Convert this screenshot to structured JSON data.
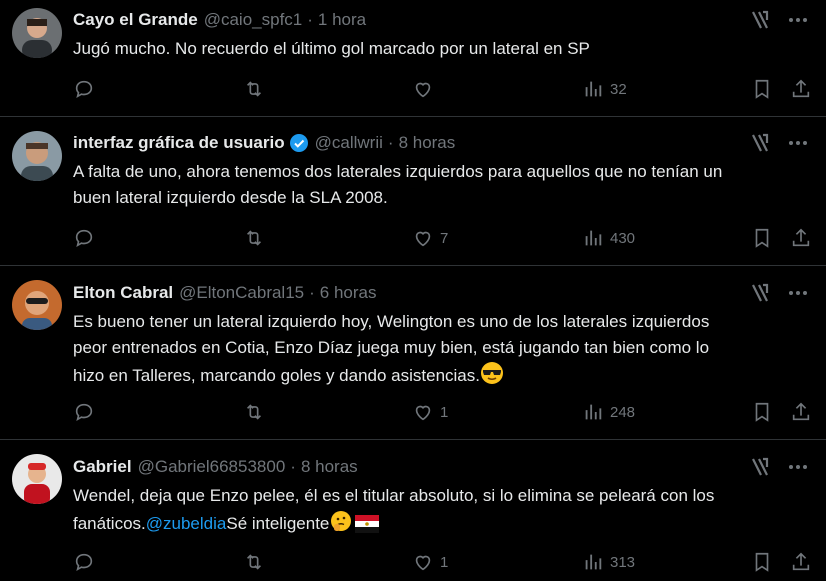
{
  "tweets": [
    {
      "name": "Cayo el Grande",
      "handle": "@caio_spfc1",
      "time": "1 hora",
      "verified": false,
      "lines": [
        "Jugó mucho. No recuerdo el último gol marcado por un lateral en SP"
      ],
      "likes": "",
      "views": "32"
    },
    {
      "name": "interfaz gráfica de usuario",
      "handle": "@callwrii",
      "time": "8 horas",
      "verified": true,
      "lines": [
        "A falta de uno, ahora tenemos dos laterales izquierdos para aquellos que no tenían un",
        "buen lateral izquierdo desde la SLA 2008."
      ],
      "likes": "7",
      "views": "430"
    },
    {
      "name": "Elton Cabral",
      "handle": "@EltonCabral15",
      "time": "6 horas",
      "verified": false,
      "lines": [
        "Es bueno tener un lateral izquierdo hoy, Welington es uno de los laterales izquierdos",
        "peor entrenados en Cotia, Enzo Díaz juega muy bien, está jugando tan bien como lo",
        "hizo en Talleres, marcando goles y dando asistencias."
      ],
      "likes": "1",
      "views": "248"
    },
    {
      "name": "Gabriel",
      "handle": "@Gabriel66853800",
      "time": "8 horas",
      "verified": false,
      "lines": [
        "Wendel, deja que Enzo pelee, él es el titular absoluto, si lo elimina se peleará con los"
      ],
      "line2_prefix": "fanáticos.",
      "line2_mention": "@zubeldia",
      "line2_suffix": "Sé inteligente",
      "likes": "1",
      "views": "313"
    }
  ],
  "separator": "·",
  "colors": {
    "background": "#000000",
    "text": "#e7e9ea",
    "muted": "#71767b",
    "link": "#1d9bf0",
    "verified": "#1d9bf0",
    "divider": "#2f3336"
  },
  "icons": [
    "reply-icon",
    "retweet-icon",
    "like-icon",
    "views-icon",
    "bookmark-icon",
    "share-icon",
    "grok-icon",
    "more-icon",
    "verified-icon"
  ]
}
